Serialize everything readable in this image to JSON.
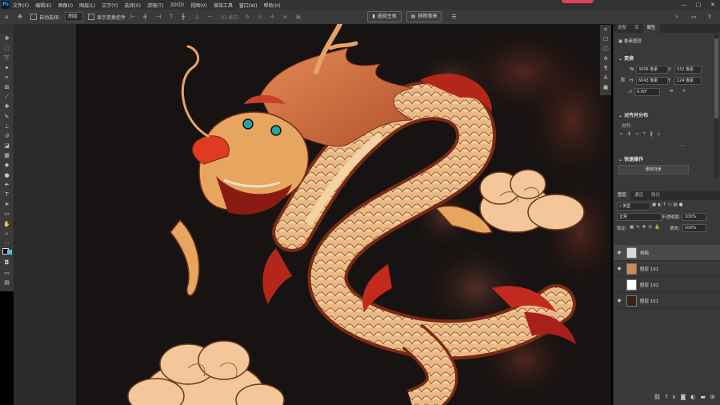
{
  "app": {
    "logo": "Ps"
  },
  "menu": [
    "文件(F)",
    "编辑(E)",
    "图像(I)",
    "图层(L)",
    "文字(Y)",
    "选择(S)",
    "滤镜(T)",
    "3D(D)",
    "视图(V)",
    "增效工具",
    "窗口(W)",
    "帮助(H)"
  ],
  "window_controls": [
    "—",
    "▢",
    "✕"
  ],
  "options": {
    "auto_select": "自动选择:",
    "layer_select": "图层",
    "show_transform": "显示变换控件",
    "mode_3d": "3D 模式:",
    "select_subject": "选择主体",
    "remove_bg": "移除背景"
  },
  "properties_tabs": [
    "调整",
    "库",
    "属性"
  ],
  "properties": {
    "layer_type": "像素图层",
    "transform": "变换",
    "w_label": "W",
    "w_value": "3006 像素",
    "x_label": "X",
    "x_value": "532 像素",
    "h_label": "H",
    "h_value": "6043 像素",
    "y_label": "Y",
    "y_value": "124 像素",
    "angle": "0.00°",
    "align": "对齐并分布",
    "align_sub": "对齐:",
    "quick_actions": "快速操作",
    "remove_bg_btn": "删除背景"
  },
  "layers_tabs": [
    "图层",
    "通道",
    "路径"
  ],
  "layers_panel": {
    "filter_kind": "类型",
    "blend_mode": "正常",
    "opacity_label": "不透明度:",
    "opacity_value": "100%",
    "lock_label": "锁定:",
    "fill_label": "填充:",
    "fill_value": "100%"
  },
  "layers": [
    {
      "name": "线稿",
      "thumb": "#d9d9d9",
      "visible": true
    },
    {
      "name": "图层 191",
      "thumb": "#c98a5a",
      "visible": true
    },
    {
      "name": "图层 192",
      "thumb": "#ffffff",
      "visible": false
    },
    {
      "name": "图层 151",
      "thumb": "#3a2118",
      "visible": true
    }
  ],
  "layer_footer_icons": [
    "link-icon",
    "fx-icon",
    "mask-icon",
    "adjustment-icon",
    "folder-icon",
    "new-layer-icon",
    "trash-icon"
  ],
  "colors": {
    "accent": "#31a8ff",
    "panel": "#393939",
    "canvas_bg": "#161312"
  }
}
